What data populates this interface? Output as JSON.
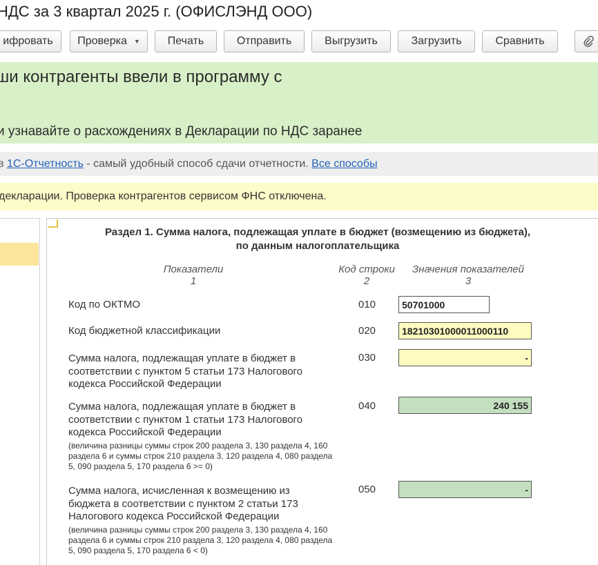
{
  "title": "НДС за 3 квартал 2025 г. (ОФИСЛЭНД ООО)",
  "toolbar": {
    "buttons": [
      {
        "label": "ифровать"
      },
      {
        "label": "Проверка"
      },
      {
        "label": "Печать"
      },
      {
        "label": "Отправить"
      },
      {
        "label": "Выгрузить"
      },
      {
        "label": "Загрузить"
      },
      {
        "label": "Сравнить"
      }
    ],
    "attach_icon": "paperclip-icon"
  },
  "green_banner": {
    "line1": "ши контрагенты ввели в программу с",
    "line2": "и узнавайте о расхождениях в Декларации по НДС заранее"
  },
  "gray_banner": {
    "prefix": "в",
    "link": "1С-Отчетность",
    "middle": " - самый удобный способ сдачи отчетности. ",
    "link2": "Все способы"
  },
  "yellow_banner": {
    "text": "декларации. Проверка контрагентов сервисом ФНС отключена."
  },
  "section": {
    "title_line1": "Раздел 1. Сумма налога, подлежащая уплате в бюджет (возмещению из бюджета),",
    "title_line2": "по данным налогоплательщика",
    "headers": {
      "col1": "Показатели",
      "col1_num": "1",
      "col2": "Код строки",
      "col2_num": "2",
      "col3": "Значения показателей",
      "col3_num": "3"
    },
    "rows": [
      {
        "label": "Код по ОКТМО",
        "code": "010",
        "value": "50701000"
      },
      {
        "label": "Код бюджетной классификации",
        "code": "020",
        "value": "18210301000011000110"
      },
      {
        "label": "Сумма налога, подлежащая уплате в бюджет в соответствии с пунктом 5 статьи 173 Налогового кодекса Российской Федерации",
        "code": "030",
        "value": "-"
      },
      {
        "label": "Сумма налога, подлежащая уплате в бюджет в соответствии с пунктом 1 статьи 173 Налогового кодекса Российской Федерации",
        "sub": "(величина разницы суммы строк 200 раздела 3, 130 раздела 4, 160 раздела 6 и суммы строк 210 раздела 3, 120 раздела 4, 080 раздела 5, 090 раздела 5, 170 раздела 6 >= 0)",
        "code": "040",
        "value": "240 155"
      },
      {
        "label": "Сумма налога, исчисленная к возмещению из бюджета в соответствии с пунктом 2 статьи 173 Налогового кодекса Российской Федерации",
        "sub": "(величина разницы суммы строк 200 раздела 3, 130 раздела 4, 160 раздела 6 и суммы строк 210 раздела 3, 120 раздела 4, 080 раздела 5, 090 раздела 5, 170 раздела 6 < 0)",
        "code": "050",
        "value": "-"
      }
    ]
  },
  "colors": {
    "green_banner": "#d8f0c8",
    "yellow_banner": "#fdfbc8",
    "field_yellow": "#fdfbc0",
    "field_green": "#c4dfc0",
    "link": "#2563b8"
  }
}
